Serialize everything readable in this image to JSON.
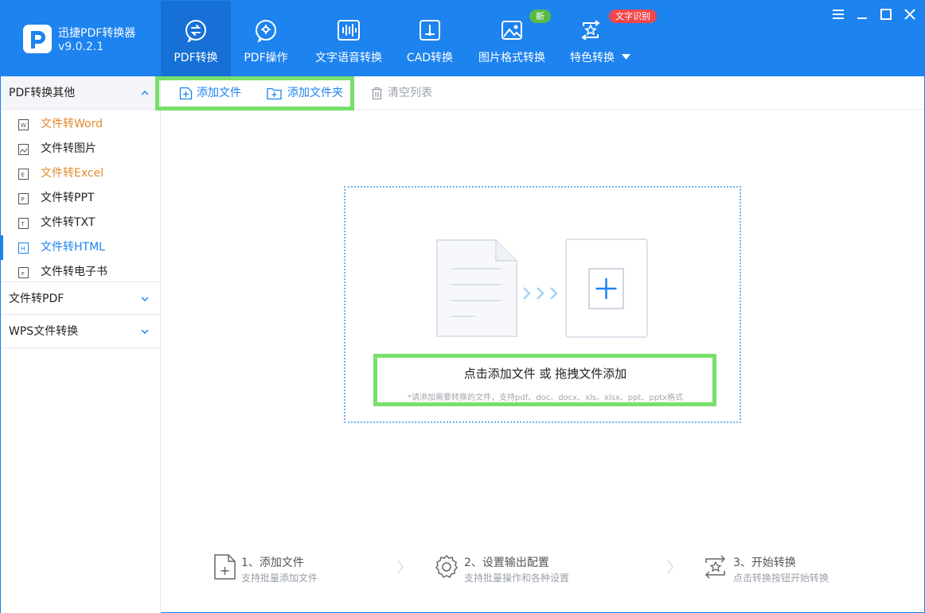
{
  "app": {
    "name": "迅捷PDF转换器",
    "version": "v9.0.2.1"
  },
  "nav": {
    "tabs": [
      {
        "label": "PDF转换",
        "icon": "pdf-convert-icon",
        "active": true
      },
      {
        "label": "PDF操作",
        "icon": "pdf-operate-icon"
      },
      {
        "label": "文字语音转换",
        "icon": "voice-wave-icon"
      },
      {
        "label": "CAD转换",
        "icon": "cad-icon"
      },
      {
        "label": "图片格式转换",
        "icon": "image-icon",
        "badge": "新"
      },
      {
        "label": "特色转换",
        "icon": "star-convert-icon",
        "badge": "文字识别"
      }
    ],
    "badge_colors": {
      "new": "#58b947",
      "ocr": "#f2474a"
    },
    "accent": "#1d83ef"
  },
  "sidebar": {
    "groups": [
      {
        "title": "PDF转换其他",
        "items": [
          {
            "label": "文件转Word",
            "icon": "word-file-icon"
          },
          {
            "label": "文件转图片",
            "icon": "image-file-icon"
          },
          {
            "label": "文件转Excel",
            "icon": "excel-file-icon"
          },
          {
            "label": "文件转PPT",
            "icon": "ppt-file-icon"
          },
          {
            "label": "文件转TXT",
            "icon": "txt-file-icon"
          },
          {
            "label": "文件转HTML",
            "icon": "html-file-icon",
            "selected": true
          },
          {
            "label": "文件转电子书",
            "icon": "ebook-file-icon"
          }
        ]
      },
      {
        "title": "文件转PDF"
      },
      {
        "title": "WPS文件转换"
      }
    ]
  },
  "toolbar": {
    "add_file": "添加文件",
    "add_folder": "添加文件夹",
    "clear_list": "清空列表"
  },
  "dropzone": {
    "title": "点击添加文件 或 拖拽文件添加",
    "subtitle": "*请添加需要转换的文件，支持pdf、doc、docx、xls、xlsx、ppt、pptx格式"
  },
  "steps": [
    {
      "title": "1、添加文件",
      "desc": "支持批量添加文件",
      "icon": "add-file-icon"
    },
    {
      "title": "2、设置输出配置",
      "desc": "支持批量操作和各种设置",
      "icon": "settings-gear-icon"
    },
    {
      "title": "3、开始转换",
      "desc": "点击转换按钮开始转换",
      "icon": "convert-start-icon"
    }
  ]
}
